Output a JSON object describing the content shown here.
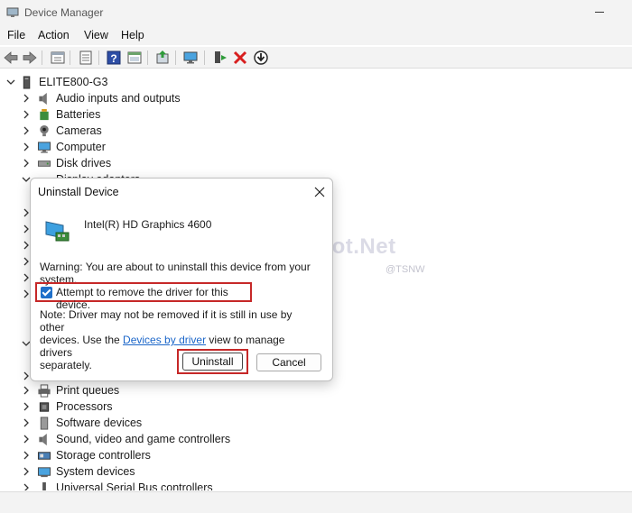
{
  "window": {
    "title": "Device Manager"
  },
  "menu": [
    "File",
    "Action",
    "View",
    "Help"
  ],
  "toolbar_icons": [
    "back-arrow-icon",
    "forward-arrow-icon",
    "properties-pane-icon",
    "device-list-icon",
    "help-icon",
    "action-pane-icon",
    "update-driver-icon",
    "scan-hardware-icon",
    "enable-device-icon",
    "uninstall-x-icon",
    "download-driver-icon"
  ],
  "tree": {
    "root": "ELITE800-G3",
    "items": [
      "Audio inputs and outputs",
      "Batteries",
      "Cameras",
      "Computer",
      "Disk drives",
      "Display adapters",
      "Print queues",
      "Processors",
      "Software devices",
      "Sound, video and game controllers",
      "Storage controllers",
      "System devices",
      "Universal Serial Bus controllers"
    ]
  },
  "watermark": {
    "text": "Technospot.Net",
    "sub": "@TSNW"
  },
  "dialog": {
    "title": "Uninstall Device",
    "device_name": "Intel(R) HD Graphics 4600",
    "warning": "Warning: You are about to uninstall this device from your system.",
    "checkbox_label": "Attempt to remove the driver for this device.",
    "checkbox_checked": true,
    "note_line1": "Note: Driver may not be removed if it is still in use by other",
    "note_line2_pre": "devices. Use the ",
    "note_link": "Devices by driver",
    "note_line2_post": " view to manage drivers",
    "note_line3": "separately.",
    "uninstall_label": "Uninstall",
    "cancel_label": "Cancel"
  },
  "colors": {
    "highlight": "#c62828",
    "accent": "#1e6fc9",
    "link": "#1b66c9"
  }
}
